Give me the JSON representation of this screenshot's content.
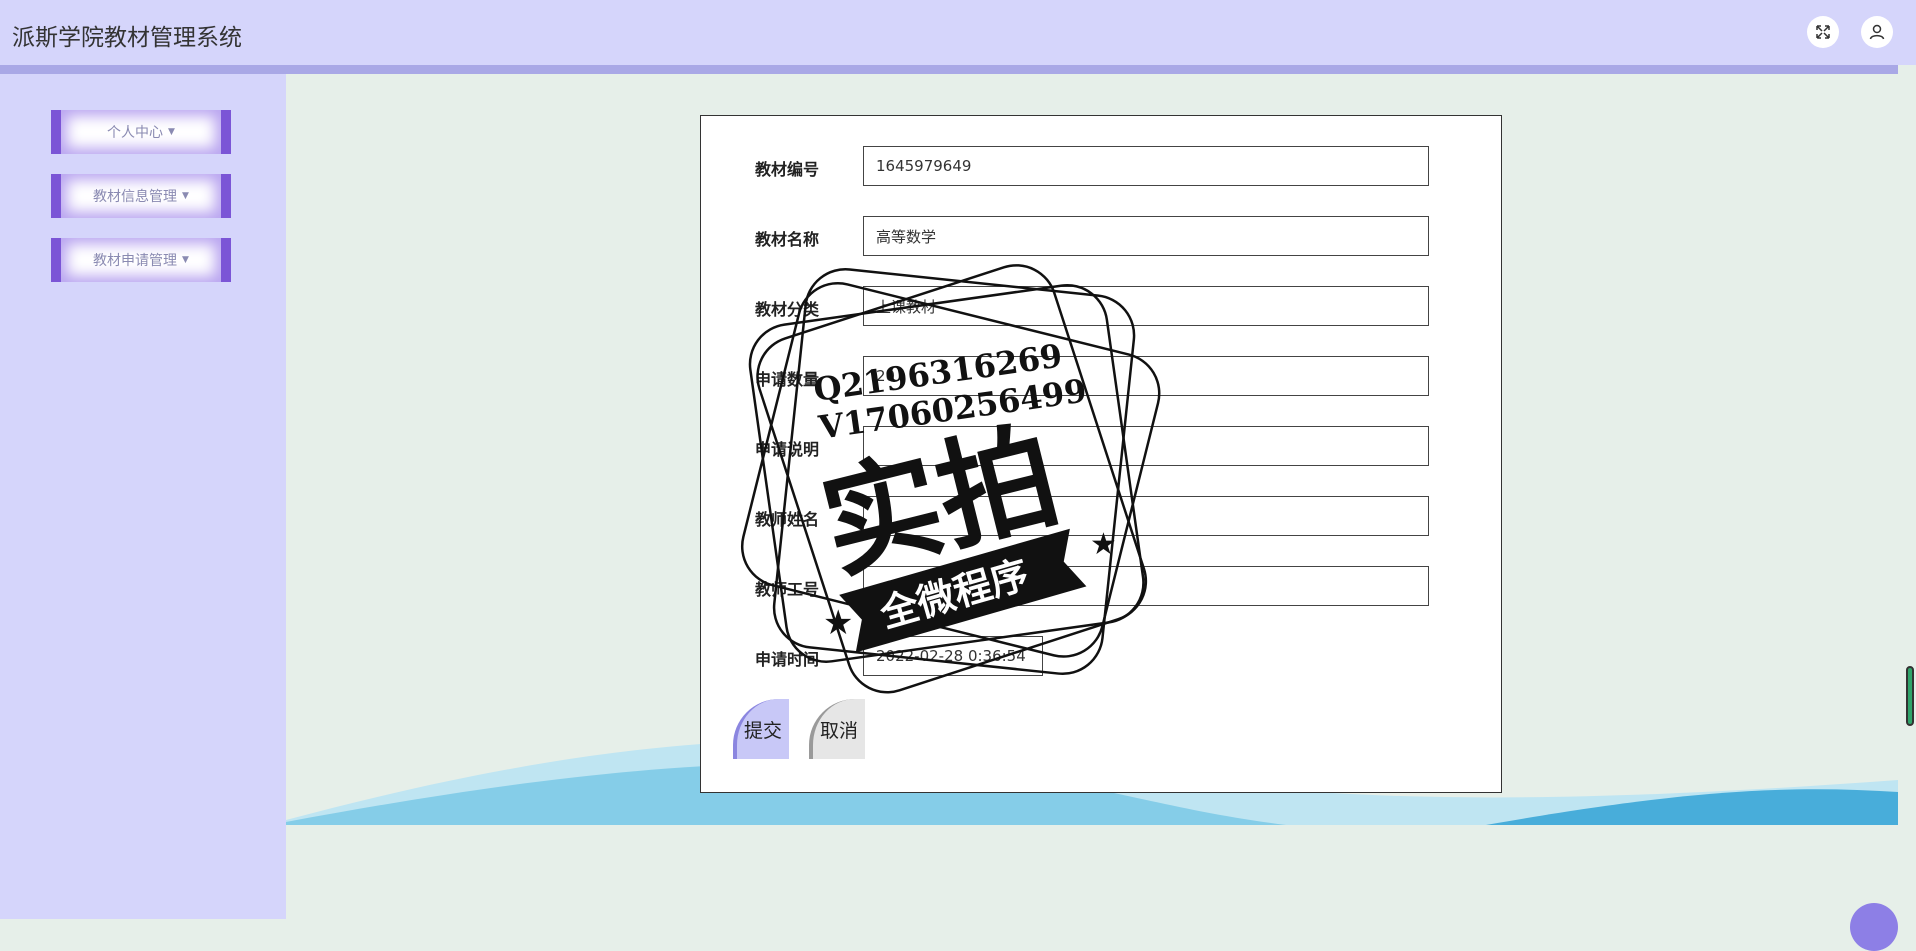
{
  "app": {
    "title": "派斯学院教材管理系统"
  },
  "header": {
    "icons": [
      "fullscreen-icon",
      "user-icon"
    ]
  },
  "sidebar": {
    "items": [
      {
        "label": "个人中心"
      },
      {
        "label": "教材信息管理"
      },
      {
        "label": "教材申请管理"
      }
    ]
  },
  "form": {
    "fields": [
      {
        "label": "教材编号",
        "value": "1645979649"
      },
      {
        "label": "教材名称",
        "value": "高等数学"
      },
      {
        "label": "教材分类",
        "value": "上课教材"
      },
      {
        "label": "申请数量",
        "value": "20"
      },
      {
        "label": "申请说明",
        "value": ""
      },
      {
        "label": "教师姓名",
        "value": ""
      },
      {
        "label": "教师工号",
        "value": ""
      },
      {
        "label": "申请时间",
        "value": "2022-02-28 0:36:54"
      }
    ],
    "submit_label": "提交",
    "cancel_label": "取消"
  },
  "watermark": {
    "qq": "Q2196316269",
    "wechat": "V17060256499",
    "main": "实拍",
    "banner": "全微程序"
  },
  "colors": {
    "header_bg": "#d5d5fb",
    "accent": "#7b55d6",
    "page_bg": "#e6efe9"
  }
}
